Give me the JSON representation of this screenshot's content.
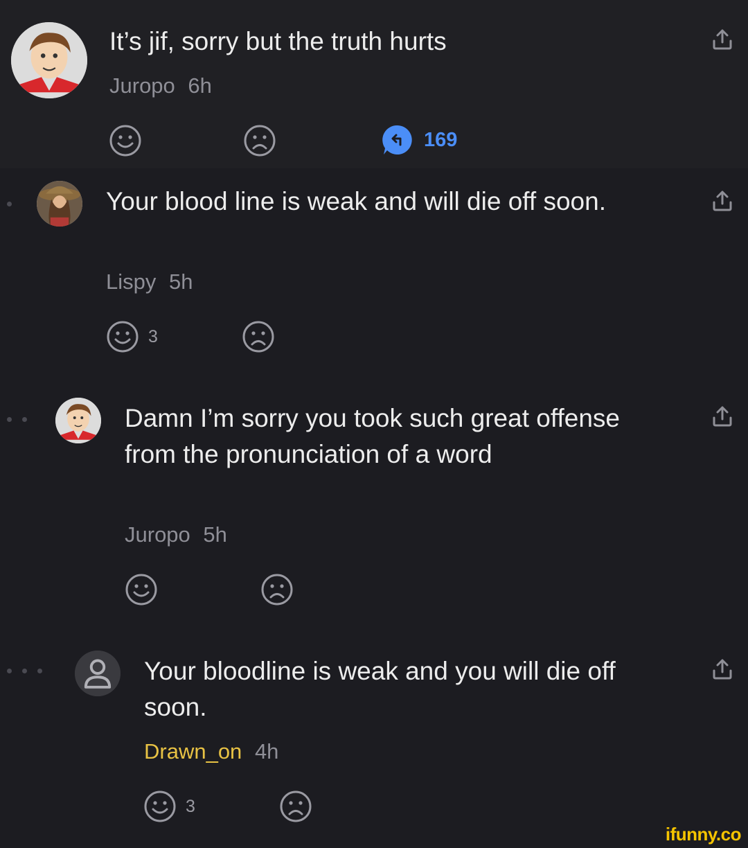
{
  "comments": [
    {
      "text": "It’s jif, sorry but the truth hurts",
      "username": "Juropo",
      "time": "6h",
      "smile_count": "",
      "reply_count": "169"
    },
    {
      "text": "Your blood line is weak and will die off soon.",
      "username": "Lispy",
      "time": "5h",
      "smile_count": "3"
    },
    {
      "text": "Damn I’m sorry you took such great offense from the pronunciation of a word",
      "username": "Juropo",
      "time": "5h",
      "smile_count": ""
    },
    {
      "text": "Your bloodline is weak and you will die off soon.",
      "username": "Drawn_on",
      "time": "4h",
      "smile_count": "3"
    }
  ],
  "icons": {
    "smile": "smile-icon",
    "frown": "frown-icon",
    "share": "share-icon",
    "reply": "reply-bubble-icon"
  },
  "colors": {
    "background": "#1c1c21",
    "accent_blue": "#4b8ef7",
    "highlight_user": "#e8c244",
    "watermark": "#f5c400"
  },
  "watermark": "ifunny.co"
}
